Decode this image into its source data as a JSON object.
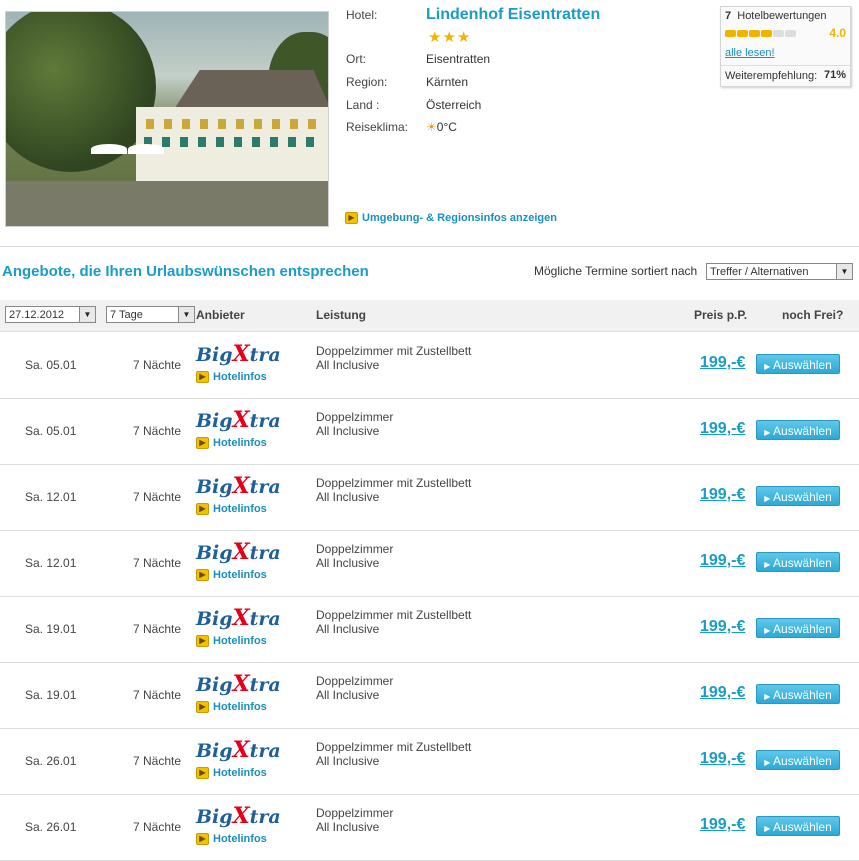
{
  "hotel": {
    "labels": {
      "hotel": "Hotel:",
      "ort": "Ort:",
      "region": "Region:",
      "land": "Land :",
      "klima": "Reiseklima:"
    },
    "name": "Lindenhof Eisentratten",
    "stars": "★★★",
    "ort": "Eisentratten",
    "region": "Kärnten",
    "land": "Österreich",
    "klima": "0°C",
    "region_link": "Umgebung- & Regionsinfos anzeigen"
  },
  "rating": {
    "count": "7",
    "label": "Hotelbewertungen",
    "score": "4.0",
    "score_fraction": 0.8,
    "read_all": "alle lesen!",
    "recommend_label": "Weiterempfehlung:",
    "recommend_value": "71%"
  },
  "offers": {
    "title": "Angebote, die Ihren Urlaubswünschen entsprechen",
    "sort_label": "Mögliche Termine sortiert nach",
    "sort_value": "Treffer / Alternativen",
    "date_value": "27.12.2012",
    "duration_value": "7 Tage",
    "headers": {
      "anbieter": "Anbieter",
      "leistung": "Leistung",
      "preis": "Preis p.P.",
      "frei": "noch Frei?"
    }
  },
  "rows": [
    {
      "date": "Sa. 05.01",
      "nights": "7 Nächte",
      "logo_a": "Big",
      "logo_x": "X",
      "logo_b": "tra",
      "info": "Hotelinfos",
      "room": "Doppelzimmer mit Zustellbett",
      "board": "All Inclusive",
      "price": "199,-€",
      "button": "Auswählen"
    },
    {
      "date": "Sa. 05.01",
      "nights": "7 Nächte",
      "logo_a": "Big",
      "logo_x": "X",
      "logo_b": "tra",
      "info": "Hotelinfos",
      "room": "Doppelzimmer",
      "board": "All Inclusive",
      "price": "199,-€",
      "button": "Auswählen"
    },
    {
      "date": "Sa. 12.01",
      "nights": "7 Nächte",
      "logo_a": "Big",
      "logo_x": "X",
      "logo_b": "tra",
      "info": "Hotelinfos",
      "room": "Doppelzimmer mit Zustellbett",
      "board": "All Inclusive",
      "price": "199,-€",
      "button": "Auswählen"
    },
    {
      "date": "Sa. 12.01",
      "nights": "7 Nächte",
      "logo_a": "Big",
      "logo_x": "X",
      "logo_b": "tra",
      "info": "Hotelinfos",
      "room": "Doppelzimmer",
      "board": "All Inclusive",
      "price": "199,-€",
      "button": "Auswählen"
    },
    {
      "date": "Sa. 19.01",
      "nights": "7 Nächte",
      "logo_a": "Big",
      "logo_x": "X",
      "logo_b": "tra",
      "info": "Hotelinfos",
      "room": "Doppelzimmer mit Zustellbett",
      "board": "All Inclusive",
      "price": "199,-€",
      "button": "Auswählen"
    },
    {
      "date": "Sa. 19.01",
      "nights": "7 Nächte",
      "logo_a": "Big",
      "logo_x": "X",
      "logo_b": "tra",
      "info": "Hotelinfos",
      "room": "Doppelzimmer",
      "board": "All Inclusive",
      "price": "199,-€",
      "button": "Auswählen"
    },
    {
      "date": "Sa. 26.01",
      "nights": "7 Nächte",
      "logo_a": "Big",
      "logo_x": "X",
      "logo_b": "tra",
      "info": "Hotelinfos",
      "room": "Doppelzimmer mit Zustellbett",
      "board": "All Inclusive",
      "price": "199,-€",
      "button": "Auswählen"
    },
    {
      "date": "Sa. 26.01",
      "nights": "7 Nächte",
      "logo_a": "Big",
      "logo_x": "X",
      "logo_b": "tra",
      "info": "Hotelinfos",
      "room": "Doppelzimmer",
      "board": "All Inclusive",
      "price": "199,-€",
      "button": "Auswählen"
    }
  ]
}
